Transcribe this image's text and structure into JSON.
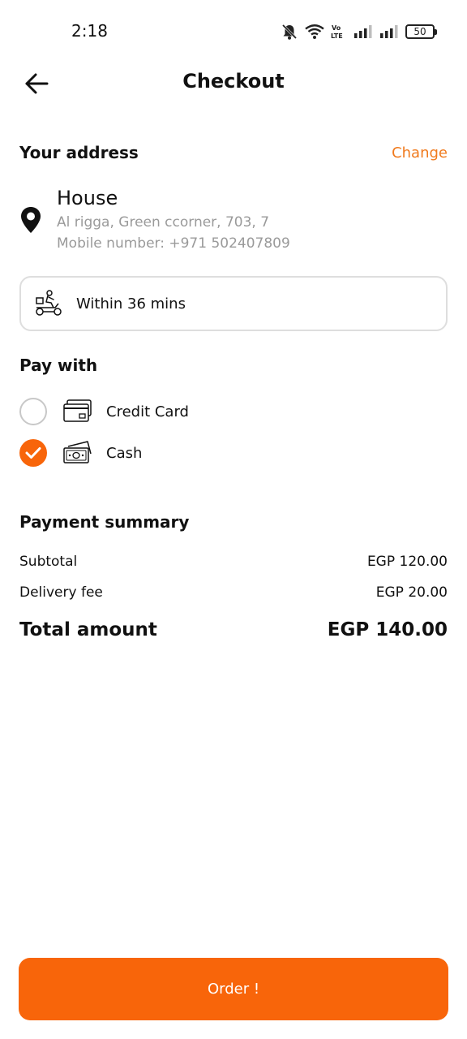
{
  "status_bar": {
    "time": "2:18",
    "battery": "50",
    "icons": [
      "mute-bell-icon",
      "wifi-icon",
      "volte-icon",
      "signal-icon",
      "signal-icon",
      "battery-icon"
    ]
  },
  "header": {
    "title": "Checkout",
    "back_icon": "arrow-left-icon"
  },
  "address": {
    "section_title": "Your address",
    "change_label": "Change",
    "name": "House",
    "line1": "Al rigga, Green ccorner, 703, 7",
    "line2": "Mobile number: +971 502407809",
    "icon": "location-pin-icon"
  },
  "delivery": {
    "text": "Within 36 mins",
    "icon": "delivery-scooter-icon"
  },
  "payment": {
    "section_title": "Pay with",
    "options": [
      {
        "label": "Credit Card",
        "icon": "credit-card-icon",
        "selected": false
      },
      {
        "label": "Cash",
        "icon": "cash-icon",
        "selected": true
      }
    ]
  },
  "summary": {
    "section_title": "Payment summary",
    "subtotal_label": "Subtotal",
    "subtotal_value": "EGP 120.00",
    "delivery_fee_label": "Delivery fee",
    "delivery_fee_value": "EGP 20.00",
    "total_label": "Total amount",
    "total_value": "EGP 140.00"
  },
  "order_button": {
    "label": "Order !"
  },
  "colors": {
    "accent": "#f8650a",
    "link": "#f07a1d",
    "muted_text": "#9a9a9a",
    "border": "#dedede"
  }
}
